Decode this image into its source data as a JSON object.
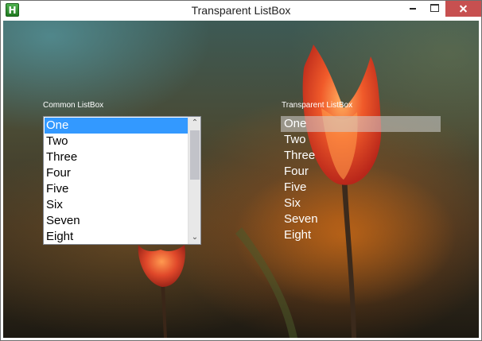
{
  "window": {
    "title": "Transparent ListBox",
    "icon": "app-h-icon",
    "icon_glyph": "H"
  },
  "common_listbox": {
    "label": "Common ListBox",
    "items": [
      "One",
      "Two",
      "Three",
      "Four",
      "Five",
      "Six",
      "Seven",
      "Eight"
    ],
    "selected_index": 0,
    "selection_color": "#3399ff",
    "scroll_up_glyph": "⌃",
    "scroll_down_glyph": "⌄"
  },
  "transparent_listbox": {
    "label": "Transparent ListBox",
    "items": [
      "One",
      "Two",
      "Three",
      "Four",
      "Five",
      "Six",
      "Seven",
      "Eight"
    ],
    "selected_index": 0
  },
  "colors": {
    "close_button": "#c75050",
    "flower_red": "#e8402a",
    "flower_orange": "#ff8a2a"
  }
}
